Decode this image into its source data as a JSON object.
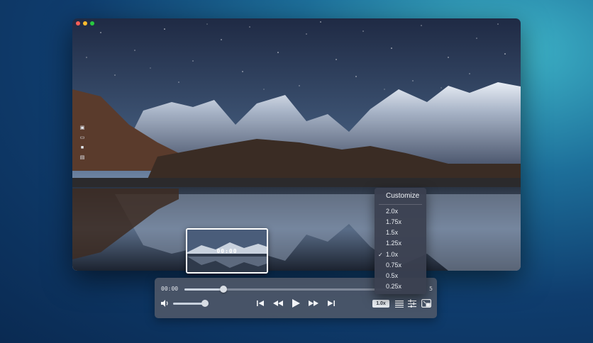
{
  "window": {
    "traffic_lights": [
      "close",
      "minimize",
      "zoom"
    ]
  },
  "colors": {
    "accent": "#ffffff",
    "controls_bg": "#505868",
    "menu_bg": "#3a4050"
  },
  "side_tools": [
    {
      "icon": "image-icon"
    },
    {
      "icon": "gif-icon"
    },
    {
      "icon": "video-camera-icon"
    },
    {
      "icon": "screenshot-icon"
    }
  ],
  "preview": {
    "time": "00:00"
  },
  "player": {
    "current_time": "00:00",
    "end_time_partial": "5",
    "progress": 0.18,
    "volume": 0.9,
    "speed_label": "1.0x",
    "buttons": [
      "skip-back-icon",
      "rewind-icon",
      "play-icon",
      "fast-forward-icon",
      "skip-forward-icon"
    ],
    "right_icons": [
      "playlist-icon",
      "equalizer-icon",
      "pip-icon"
    ]
  },
  "speed_menu": {
    "header": "Customize",
    "items": [
      {
        "label": "2.0x",
        "selected": false
      },
      {
        "label": "1.75x",
        "selected": false
      },
      {
        "label": "1.5x",
        "selected": false
      },
      {
        "label": "1.25x",
        "selected": false
      },
      {
        "label": "1.0x",
        "selected": true
      },
      {
        "label": "0.75x",
        "selected": false
      },
      {
        "label": "0.5x",
        "selected": false
      },
      {
        "label": "0.25x",
        "selected": false
      }
    ],
    "check": "✓"
  }
}
